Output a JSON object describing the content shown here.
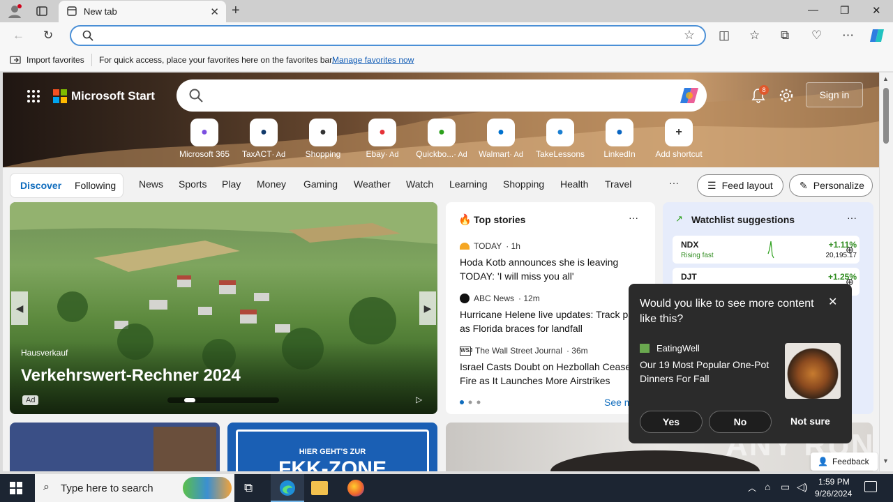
{
  "browser": {
    "tab_title": "New tab",
    "address_value": "",
    "favorites_bar": {
      "import_label": "Import favorites",
      "hint_text": "For quick access, place your favorites here on the favorites bar.",
      "manage_link": "Manage favorites now"
    }
  },
  "header": {
    "logo_text": "Microsoft Start",
    "notification_count": "8",
    "sign_in": "Sign in"
  },
  "shortcuts": [
    {
      "label": "Microsoft 365",
      "ad": "",
      "icon": "m365-icon",
      "color": "#7b4fe0"
    },
    {
      "label": "TaxACT",
      "ad": "· Ad",
      "icon": "taxact-icon",
      "color": "#123a6b"
    },
    {
      "label": "Shopping",
      "ad": "",
      "icon": "shopping-tag-icon",
      "color": "#333333"
    },
    {
      "label": "Ebay",
      "ad": "· Ad",
      "icon": "ebay-bag-icon",
      "color": "#e53238"
    },
    {
      "label": "Quickbo...",
      "ad": "· Ad",
      "icon": "quickbooks-icon",
      "color": "#2ca01c"
    },
    {
      "label": "Walmart",
      "ad": "· Ad",
      "icon": "walmart-icon",
      "color": "#0071ce"
    },
    {
      "label": "TakeLessons",
      "ad": "",
      "icon": "takelessons-icon",
      "color": "#1b7fd1"
    },
    {
      "label": "LinkedIn",
      "ad": "",
      "icon": "linkedin-icon",
      "color": "#0a66c2"
    },
    {
      "label": "Add shortcut",
      "ad": "",
      "icon": "plus-icon",
      "color": "#333333"
    }
  ],
  "nav": {
    "discover": "Discover",
    "following": "Following",
    "items": [
      "News",
      "Sports",
      "Play",
      "Money",
      "Gaming",
      "Weather",
      "Watch",
      "Learning",
      "Shopping",
      "Health",
      "Travel"
    ],
    "more": "···",
    "feed_layout": "Feed layout",
    "personalize": "Personalize"
  },
  "hero_card": {
    "category": "Hausverkauf",
    "title": "Verkehrswert-Rechner 2024",
    "ad_badge": "Ad"
  },
  "top_stories": {
    "title": "Top stories",
    "more": "···",
    "stories": [
      {
        "source": "TODAY",
        "time": "· 1h",
        "headline": "Hoda Kotb announces she is leaving TODAY: 'I will miss you all'"
      },
      {
        "source": "ABC News",
        "time": "· 12m",
        "headline": "Hurricane Helene live updates: Track path as Florida braces for landfall"
      },
      {
        "source": "The Wall Street Journal",
        "time": "· 36m",
        "headline": "Israel Casts Doubt on Hezbollah Cease-Fire as It Launches More Airstrikes"
      }
    ],
    "see_more": "See more"
  },
  "watchlist": {
    "title": "Watchlist suggestions",
    "more": "···",
    "rows": [
      {
        "symbol": "NDX",
        "note": "Rising fast",
        "change": "+1.11%",
        "price": "20,195.17"
      },
      {
        "symbol": "DJT",
        "note": "",
        "change": "+1.25%",
        "price": ""
      }
    ]
  },
  "lower_cards": {
    "fkk_line1": "HIER GEHT'S ZUR",
    "fkk_line2": "FKK-ZONE"
  },
  "popup": {
    "question": "Would you like to see more content like this?",
    "source": "EatingWell",
    "headline": "Our 19 Most Popular One-Pot Dinners For Fall",
    "yes": "Yes",
    "no": "No",
    "not_sure": "Not sure"
  },
  "feedback": "Feedback",
  "watermark": "ANY RUN",
  "taskbar": {
    "search_placeholder": "Type here to search",
    "time": "1:59 PM",
    "date": "9/26/2024"
  }
}
